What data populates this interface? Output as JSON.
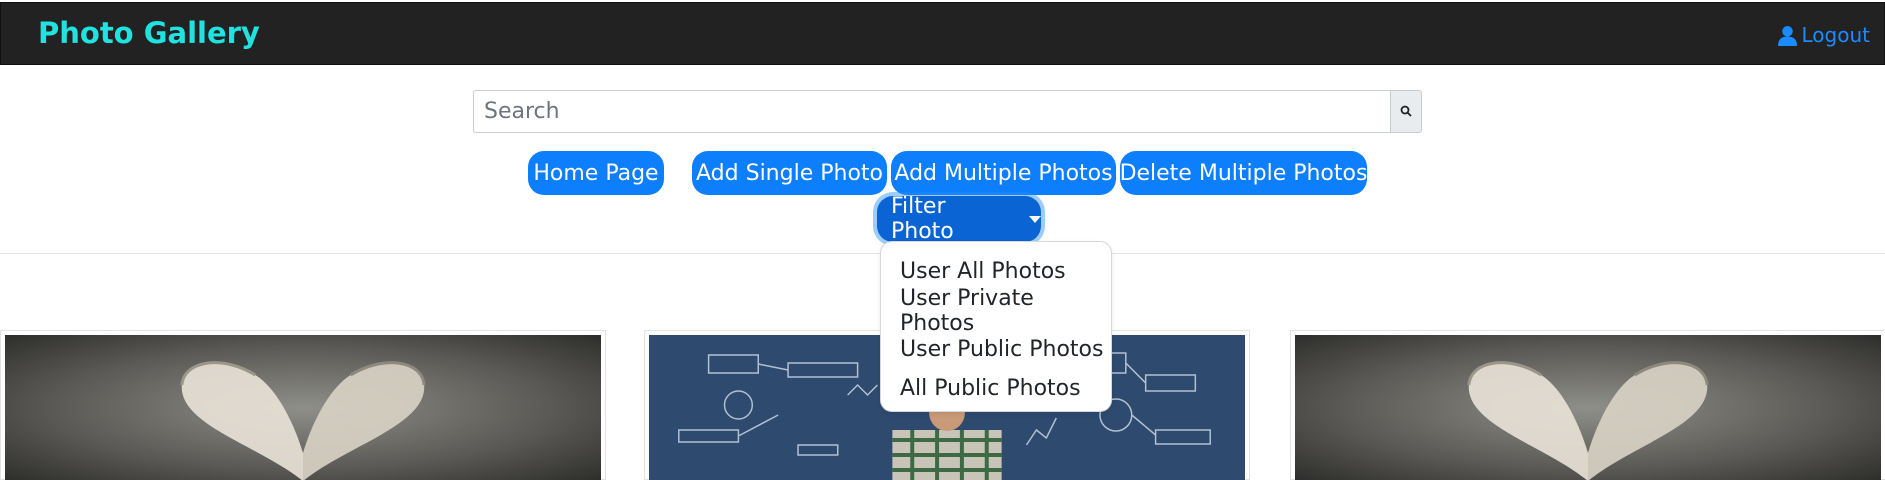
{
  "app": {
    "title": "Photo Gallery",
    "logout_label": "Logout"
  },
  "search": {
    "placeholder": "Search",
    "value": ""
  },
  "actions": {
    "home": "Home Page",
    "add_single": "Add Single Photo",
    "add_multiple": "Add Multiple Photos",
    "delete_multiple": "Delete Multiple Photos"
  },
  "filter": {
    "label": "Filter Photo",
    "options": [
      "User All Photos",
      "User Private Photos",
      "User Public Photos",
      "All Public Photos"
    ]
  },
  "gallery": {
    "photos": [
      {
        "subject": "heart-shaped book pages"
      },
      {
        "subject": "man in front of chalkboard sketches"
      },
      {
        "subject": "heart-shaped book pages"
      }
    ]
  },
  "colors": {
    "navbar": "#222222",
    "brand": "#1fe3e0",
    "link": "#1a8cff",
    "button": "#0d7efc",
    "button_active": "#0a64d4"
  },
  "icons": {
    "logout": "user-icon",
    "search": "search-icon",
    "dropdown": "caret-down-icon"
  }
}
